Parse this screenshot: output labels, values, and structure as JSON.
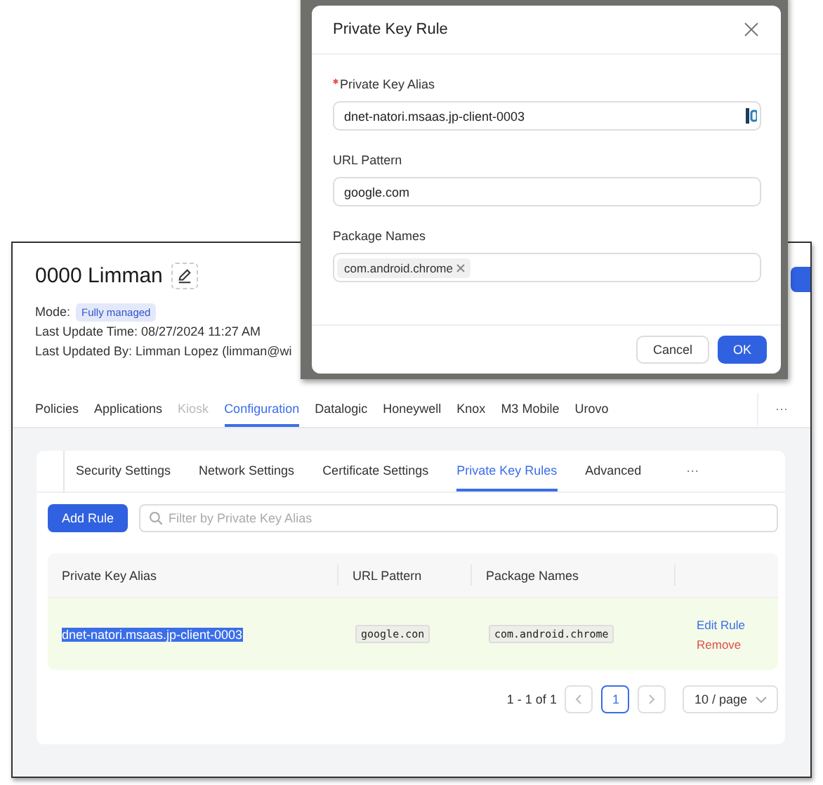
{
  "page": {
    "title": "0000 Limman",
    "mode_label": "Mode:",
    "mode": "Fully managed",
    "last_update": "Last Update Time: 08/27/2024 11:27 AM",
    "last_updated_by": "Last Updated By: Limman Lopez (limman@wi"
  },
  "tabs": [
    {
      "label": "Policies",
      "selected": false,
      "disabled": false
    },
    {
      "label": "Applications",
      "selected": false,
      "disabled": false
    },
    {
      "label": "Kiosk",
      "selected": false,
      "disabled": true
    },
    {
      "label": "Configuration",
      "selected": true,
      "disabled": false
    },
    {
      "label": "Datalogic",
      "selected": false,
      "disabled": false
    },
    {
      "label": "Honeywell",
      "selected": false,
      "disabled": false
    },
    {
      "label": "Knox",
      "selected": false,
      "disabled": false
    },
    {
      "label": "M3 Mobile",
      "selected": false,
      "disabled": false
    },
    {
      "label": "Urovo",
      "selected": false,
      "disabled": false
    }
  ],
  "tabs_more": "···",
  "subtabs": [
    {
      "label": "Security Settings",
      "selected": false
    },
    {
      "label": "Network Settings",
      "selected": false
    },
    {
      "label": "Certificate Settings",
      "selected": false
    },
    {
      "label": "Private Key Rules",
      "selected": true
    },
    {
      "label": "Advanced",
      "selected": false
    }
  ],
  "subtabs_more": "···",
  "add_button": "Add Rule",
  "filter": {
    "placeholder": "Filter by Private Key Alias"
  },
  "table": {
    "columns": [
      "Private Key Alias",
      "URL Pattern",
      "Package Names"
    ],
    "rows": [
      {
        "alias": "dnet-natori.msaas.jp-client-0003",
        "alias_text_selected": true,
        "highlighted": true,
        "url": "google.con",
        "package": "com.android.chrome",
        "actions": [
          {
            "label": "Edit Rule",
            "kind": "edit"
          },
          {
            "label": "Remove",
            "kind": "remove"
          }
        ]
      }
    ]
  },
  "pagination": {
    "range": "1 - 1 of 1",
    "pages": [
      {
        "label": "1",
        "selected": true
      }
    ],
    "page_size": "10 / page"
  },
  "dialog": {
    "title": "Private Key Rule",
    "fields": [
      {
        "label": "Private Key Alias",
        "required": true,
        "value": "dnet-natori.msaas.jp-client-0003",
        "kind": "text",
        "autofill": true
      },
      {
        "label": "URL Pattern",
        "required": false,
        "value": "google.com",
        "kind": "text",
        "autofill": false
      },
      {
        "label": "Package Names",
        "required": false,
        "kind": "tags",
        "tags": [
          "com.android.chrome"
        ]
      }
    ],
    "buttons": [
      {
        "label": "Cancel",
        "primary": false
      },
      {
        "label": "OK",
        "primary": true
      }
    ]
  }
}
